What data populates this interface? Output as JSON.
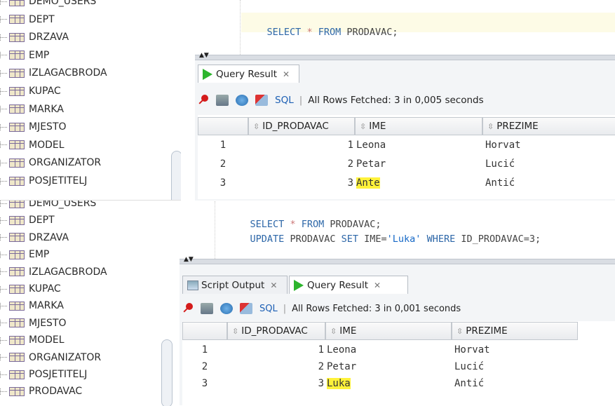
{
  "tree_top": {
    "items": [
      "DEMO_USERS",
      "DEPT",
      "DRZAVA",
      "EMP",
      "IZLAGACBRODA",
      "KUPAC",
      "MARKA",
      "MJESTO",
      "MODEL",
      "ORGANIZATOR",
      "POSJETITELJ"
    ]
  },
  "tree_bottom": {
    "items": [
      "DEMO_USERS",
      "DEPT",
      "DRZAVA",
      "EMP",
      "IZLAGACBRODA",
      "KUPAC",
      "MARKA",
      "MJESTO",
      "MODEL",
      "ORGANIZATOR",
      "POSJETITELJ",
      "PRODAVAC"
    ]
  },
  "top_panel": {
    "editor_line1": "SELECT * FROM PRODAVAC;",
    "tab_query_result": "Query Result",
    "toolbar_sql": "SQL",
    "toolbar_status": "All Rows Fetched: 3 in 0,005 seconds",
    "columns": [
      "ID_PRODAVAC",
      "IME",
      "PREZIME"
    ],
    "rows": [
      {
        "n": "1",
        "id": "1",
        "ime": "Leona",
        "prezime": "Horvat"
      },
      {
        "n": "2",
        "id": "2",
        "ime": "Petar",
        "prezime": "Lucić"
      },
      {
        "n": "3",
        "id": "3",
        "ime": "Ante",
        "prezime": "Antić"
      }
    ]
  },
  "bottom_panel": {
    "editor_line1": "SELECT * FROM PRODAVAC;",
    "editor_line2_kw1": "UPDATE",
    "editor_line2_t1": "PRODAVAC",
    "editor_line2_kw2": "SET",
    "editor_line2_t2": "IME=",
    "editor_line2_str": "'Luka'",
    "editor_line2_kw3": "WHERE",
    "editor_line2_t3": "ID_PRODAVAC=3;",
    "tab_script_output": "Script Output",
    "tab_query_result": "Query Result",
    "toolbar_sql": "SQL",
    "toolbar_status": "All Rows Fetched: 3 in 0,001 seconds",
    "columns": [
      "ID_PRODAVAC",
      "IME",
      "PREZIME"
    ],
    "rows": [
      {
        "n": "1",
        "id": "1",
        "ime": "Leona",
        "prezime": "Horvat"
      },
      {
        "n": "2",
        "id": "2",
        "ime": "Petar",
        "prezime": "Lucić"
      },
      {
        "n": "3",
        "id": "3",
        "ime": "Luka",
        "prezime": "Antić"
      }
    ]
  },
  "colors": {
    "highlight": "#fff23a",
    "keyword": "#2d67a8",
    "play_icon": "#2db52d"
  }
}
